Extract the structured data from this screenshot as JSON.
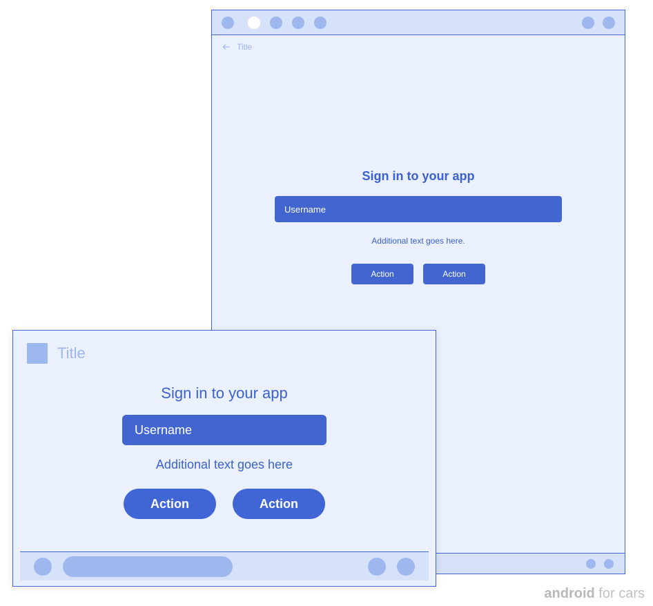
{
  "tablet": {
    "title": "Title",
    "heading": "Sign in to your app",
    "input_placeholder": "Username",
    "subtext": "Additional text goes here.",
    "action1": "Action",
    "action2": "Action"
  },
  "phone": {
    "title": "Title",
    "heading": "Sign in to your app",
    "input_placeholder": "Username",
    "subtext": "Additional text goes here",
    "action1": "Action",
    "action2": "Action"
  },
  "caption": {
    "brand": "android",
    "suffix": " for cars"
  }
}
